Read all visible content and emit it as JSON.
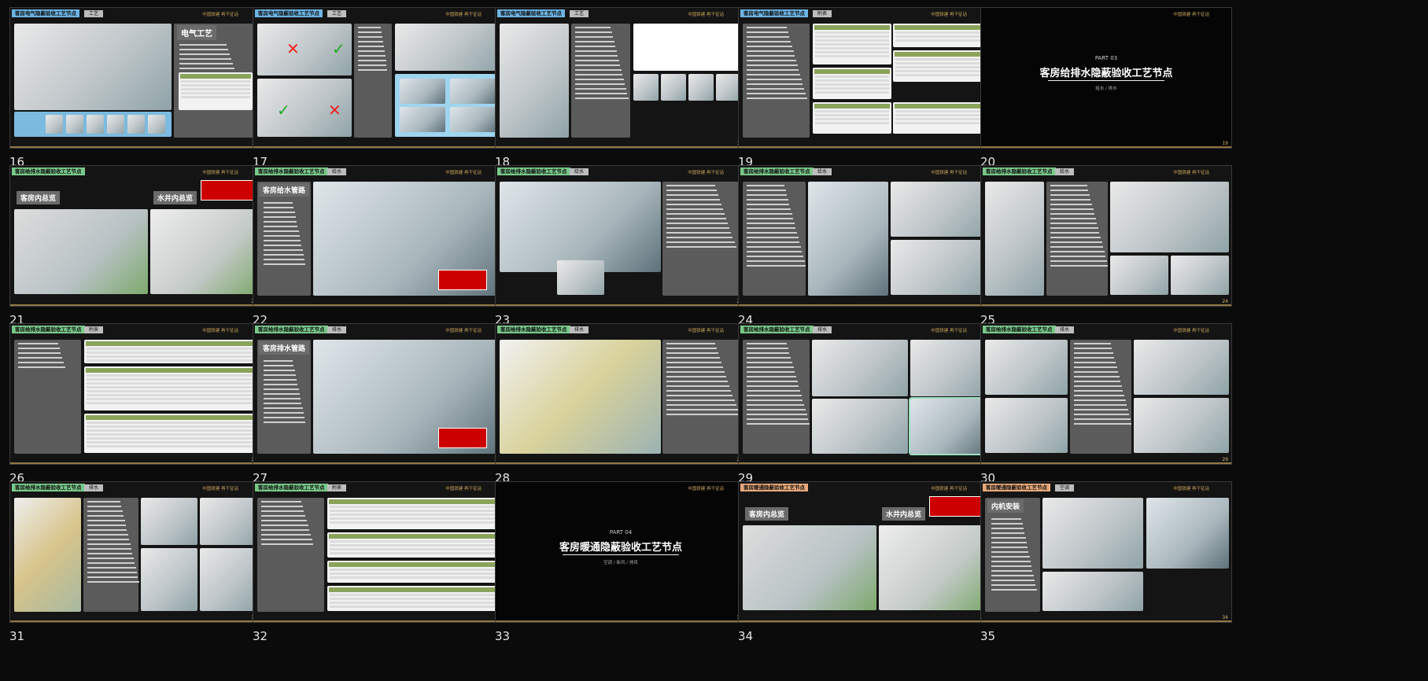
{
  "slides": [
    {
      "num": "16",
      "page": "15",
      "title": "客房电气隐蔽验收工艺节点",
      "tag": "工艺",
      "brand": "中国铁建 再干征话",
      "heading": "电气工艺",
      "type": "electric"
    },
    {
      "num": "17",
      "page": "16",
      "title": "客房电气隐蔽验收工艺节点",
      "tag": "工艺",
      "brand": "中国铁建 再干征话",
      "type": "wiring"
    },
    {
      "num": "18",
      "page": "17",
      "title": "客房电气隐蔽验收工艺节点",
      "tag": "工艺",
      "brand": "中国铁建 再干征话",
      "type": "pipes"
    },
    {
      "num": "19",
      "page": "18",
      "title": "客房电气隐蔽验收工艺节点",
      "tag": "附表",
      "brand": "中国铁建 再干征话",
      "type": "tables"
    },
    {
      "num": "20",
      "page": "19",
      "brand": "中国铁建 再干征话",
      "type": "cover",
      "part": "PART 03",
      "cover_title": "客房给排水隐蔽验收工艺节点",
      "cover_sub": "给水 / 排水"
    },
    {
      "num": "21",
      "page": "20",
      "title": "客房给排水隐蔽验收工艺节点",
      "brand": "中国铁建 再干征话",
      "type": "overview",
      "label_a": "客房内总览",
      "label_b": "水井内总览"
    },
    {
      "num": "22",
      "page": "21",
      "title": "客房给排水隐蔽验收工艺节点",
      "tag": "给水",
      "brand": "中国铁建 再干征话",
      "heading": "客房给水管路",
      "type": "room"
    },
    {
      "num": "23",
      "page": "22",
      "title": "客房给排水隐蔽验收工艺节点",
      "tag": "给水",
      "brand": "中国铁建 再干征话",
      "type": "room3d"
    },
    {
      "num": "24",
      "page": "23",
      "title": "客房给排水隐蔽验收工艺节点",
      "tag": "给水",
      "brand": "中国铁建 再干征话",
      "type": "multi"
    },
    {
      "num": "25",
      "page": "24",
      "title": "客房给排水隐蔽验收工艺节点",
      "tag": "给水",
      "brand": "中国铁建 再干征话",
      "type": "multi2"
    },
    {
      "num": "26",
      "page": "25",
      "title": "客房给排水隐蔽验收工艺节点",
      "tag": "附表",
      "brand": "中国铁建 再干征话",
      "type": "tables2"
    },
    {
      "num": "27",
      "page": "26",
      "title": "客房给排水隐蔽验收工艺节点",
      "tag": "排水",
      "brand": "中国铁建 再干征话",
      "heading": "客房排水管路",
      "type": "room"
    },
    {
      "num": "28",
      "page": "27",
      "title": "客房给排水隐蔽验收工艺节点",
      "tag": "排水",
      "brand": "中国铁建 再干征话",
      "type": "yellow"
    },
    {
      "num": "29",
      "page": "28",
      "title": "客房给排水隐蔽验收工艺节点",
      "tag": "排水",
      "brand": "中国铁建 再干征话",
      "type": "insul"
    },
    {
      "num": "30",
      "page": "29",
      "title": "客房给排水隐蔽验收工艺节点",
      "tag": "排水",
      "brand": "中国铁建 再干征话",
      "type": "drain"
    },
    {
      "num": "31",
      "page": "30",
      "title": "客房给排水隐蔽验收工艺节点",
      "tag": "排水",
      "brand": "中国铁建 再干征话",
      "type": "fittings"
    },
    {
      "num": "32",
      "page": "31",
      "title": "客房给排水隐蔽验收工艺节点",
      "tag": "附表",
      "brand": "中国铁建 再干征话",
      "type": "tables3"
    },
    {
      "num": "33",
      "page": "32",
      "brand": "中国铁建 再干征话",
      "type": "cover",
      "part": "PART 04",
      "cover_title": "客房暖通隐蔽验收工艺节点",
      "cover_sub": "空调 / 新风 / 排风"
    },
    {
      "num": "34",
      "page": "33",
      "title": "客房暖通隐蔽验收工艺节点",
      "brand": "中国铁建 再干征话",
      "type": "overview2",
      "label_a": "客房内总览",
      "label_b": "水井内总览"
    },
    {
      "num": "35",
      "page": "34",
      "title": "客房暖通隐蔽验收工艺节点",
      "tag": "空调",
      "brand": "中国铁建 再干征话",
      "heading": "内机安装",
      "type": "hvac"
    }
  ]
}
